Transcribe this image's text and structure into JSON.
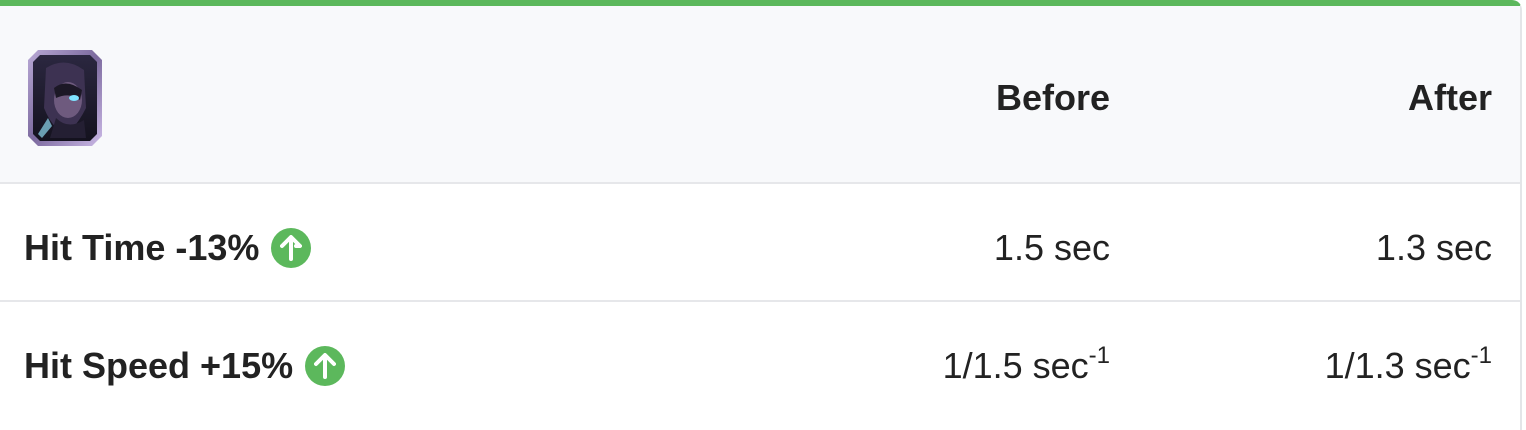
{
  "header": {
    "card_icon": "witch-card-icon",
    "before_label": "Before",
    "after_label": "After"
  },
  "rows": [
    {
      "label": "Hit Time -13%",
      "icon": "arrow-up-circle-icon",
      "before": "1.5 sec",
      "after": "1.3 sec",
      "before_sup": "",
      "after_sup": ""
    },
    {
      "label": "Hit Speed +15%",
      "icon": "arrow-up-circle-icon",
      "before": "1/1.5 sec",
      "after": "1/1.3 sec",
      "before_sup": "-1",
      "after_sup": "-1"
    }
  ],
  "colors": {
    "accent": "#5cb85c",
    "header_bg": "#f8f9fb",
    "border": "#e6e7ea"
  }
}
